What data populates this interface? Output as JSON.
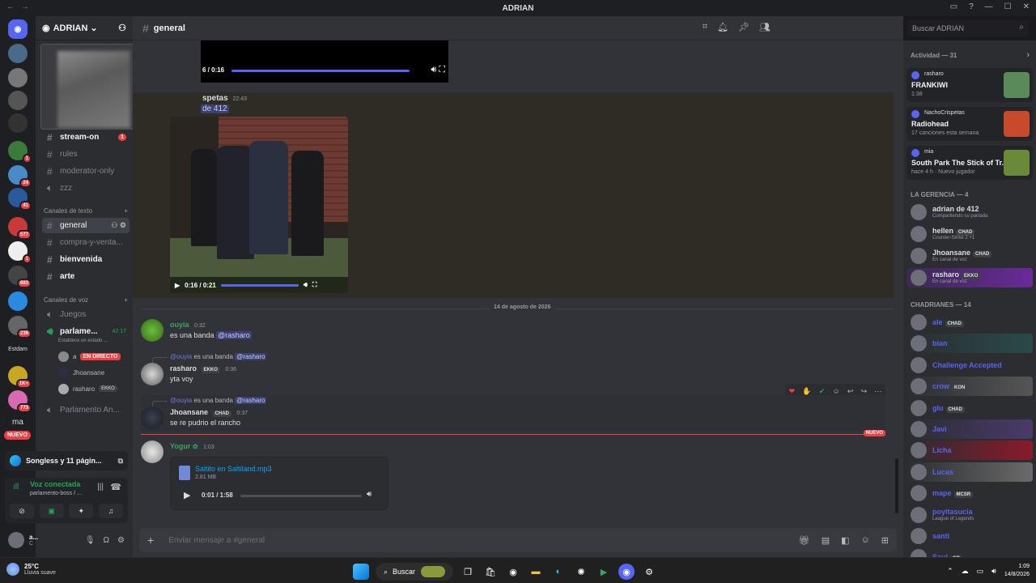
{
  "window": {
    "title": "ADRIAN"
  },
  "rail": {
    "servers": [
      {
        "label": "",
        "color": "#5865f2",
        "badge": ""
      },
      {
        "label": "",
        "color": "#4a6a8a",
        "badge": ""
      },
      {
        "label": "",
        "color": "#777777",
        "badge": ""
      },
      {
        "label": "",
        "color": "#555555",
        "badge": ""
      },
      {
        "label": "",
        "color": "#333333",
        "badge": ""
      },
      {
        "label": "",
        "color": "#3a7a3a",
        "badge": "1"
      },
      {
        "label": "",
        "color": "#4a8ac8",
        "badge": "24"
      },
      {
        "label": "",
        "color": "#2a5a9a",
        "badge": "41"
      },
      {
        "label": "",
        "color": "#c83a3a",
        "badge": "577"
      },
      {
        "label": "",
        "color": "#eeeeee",
        "badge": "1"
      },
      {
        "label": "",
        "color": "#444444",
        "badge": "683"
      },
      {
        "label": "",
        "color": "#2a8adf",
        "badge": ""
      },
      {
        "label": "",
        "color": "#666666",
        "badge": "236"
      }
    ],
    "folder_label": "Estdam",
    "ma_label": "ma",
    "server_badges_bottom": [
      "1K+",
      "773"
    ],
    "new_pill": "NUEVO"
  },
  "sidebar": {
    "guild_name": "ADRIAN",
    "channels_top": [
      {
        "name": "stream-on",
        "bold": true,
        "badge": "1"
      },
      {
        "name": "rules",
        "bold": false
      },
      {
        "name": "moderator-only",
        "bold": false
      },
      {
        "name": "zzz",
        "bold": false
      }
    ],
    "text_category": "Canales de texto",
    "text_channels": [
      {
        "name": "general",
        "active": true
      },
      {
        "name": "compra-y-venta...",
        "active": false
      },
      {
        "name": "bienvenida",
        "active": false,
        "bold": true
      },
      {
        "name": "arte",
        "active": false,
        "bold": true
      }
    ],
    "voice_category": "Canales de voz",
    "voice_channels": [
      {
        "name": "Juegos"
      },
      {
        "name": "parlame...",
        "timer": "42:17",
        "status": "Establece un estado ..."
      }
    ],
    "voice_users": [
      {
        "name": "a",
        "live": "EN DIRECTO"
      },
      {
        "name": "Jhoansane",
        "chip": ""
      },
      {
        "name": "rasharo",
        "chip": "EKKO"
      }
    ],
    "channel_after": "Parlamento An...",
    "edge_panel": "Songless y 11 págin...",
    "voice_panel": {
      "status": "Voz conectada",
      "sub": "parlamento-boss / ..."
    },
    "user": {
      "name": "a...",
      "sub": "C"
    }
  },
  "channel": {
    "name": "general",
    "search_placeholder": "Buscar ADRIAN"
  },
  "messages": {
    "video_strip_time": "6 / 0:16",
    "highlight_author": "spetas",
    "highlight_time": "22:43",
    "highlight_mention": "de 412",
    "video_time": "0:16 / 0:21",
    "date_divider": "14 de agosto de 2026",
    "items": [
      {
        "author": "ouyia",
        "color": "#3ba55c",
        "time": "0:32",
        "text": "es una banda",
        "mention": "@rasharo"
      },
      {
        "author": "rasharo",
        "color": "#dbdee1",
        "tag": "EKKO",
        "time": "0:36",
        "text": "yta voy",
        "reply_name": "@ouyia",
        "reply_text": "es una banda",
        "reply_mention": "@rasharo"
      },
      {
        "author": "Jhoansane",
        "color": "#dbdee1",
        "tag": "CHAD",
        "time": "0:37",
        "text": "se re pudrio el rancho",
        "reply_name": "@ouyia",
        "reply_text": "es una banda",
        "reply_mention": "@rasharo"
      },
      {
        "author": "Yogur",
        "color": "#3ba55c",
        "time": "1:03",
        "text": ""
      }
    ],
    "new_label": "NUEVO",
    "audio": {
      "file": "Saltito en Saltiland.mp3",
      "size": "2.81 MB",
      "time": "0:01 / 1:58"
    }
  },
  "composer": {
    "placeholder": "Enviar mensaje a #general"
  },
  "members": {
    "activity_header": "Actividad — 31",
    "activity": [
      {
        "user": "rasharo",
        "title": "FRANKIWI",
        "detail": "1:38",
        "art": "#5a8a5a"
      },
      {
        "user": "NachoCrispetas",
        "title": "Radiohead",
        "detail": "17 canciones esta semana",
        "art": "#c84a2a"
      },
      {
        "user": "mia",
        "title": "South Park The Stick of Tr...",
        "detail": "hace 4 h · Nuevo jugador",
        "art": "#6a8a3a"
      }
    ],
    "group1_header": "LA GERENCIA — 4",
    "group1": [
      {
        "name": "adrian de 412",
        "sub": "Compartiendo su pantalla",
        "color": "#dbdee1",
        "tag": ""
      },
      {
        "name": "hellen",
        "sub": "Counter-Strike 2 +1",
        "color": "#dbdee1",
        "tag": "CHAD"
      },
      {
        "name": "Jhoansane",
        "sub": "En canal de voz",
        "color": "#dbdee1",
        "tag": "CHAD"
      },
      {
        "name": "rasharo",
        "sub": "En canal de voz",
        "color": "#dbdee1",
        "tag": "EKKO"
      }
    ],
    "group2_header": "CHADRIANES — 14",
    "group2": [
      {
        "name": "ale",
        "sub": "",
        "color": "#5865f2",
        "tag": "CHAD"
      },
      {
        "name": "bian",
        "sub": "",
        "color": "#5865f2",
        "tag": ""
      },
      {
        "name": "Challenge Accepted",
        "sub": "",
        "color": "#5865f2",
        "tag": ""
      },
      {
        "name": "crow",
        "sub": "",
        "color": "#5865f2",
        "tag": "KON"
      },
      {
        "name": "glu",
        "sub": "",
        "color": "#5865f2",
        "tag": "CHAD"
      },
      {
        "name": "Javi",
        "sub": "",
        "color": "#5865f2",
        "tag": ""
      },
      {
        "name": "Licha",
        "sub": "",
        "color": "#5865f2",
        "tag": ""
      },
      {
        "name": "Lucas",
        "sub": "",
        "color": "#5865f2",
        "tag": ""
      },
      {
        "name": "mape",
        "sub": "",
        "color": "#5865f2",
        "tag": "MCSR"
      },
      {
        "name": "poyitasucia",
        "sub": "League of Legends",
        "color": "#5865f2",
        "tag": ""
      },
      {
        "name": "santi",
        "sub": "",
        "color": "#5865f2",
        "tag": ""
      },
      {
        "name": "Saul",
        "sub": "",
        "color": "#5865f2",
        "tag": "GB"
      }
    ]
  },
  "taskbar": {
    "temp": "25°C",
    "condition": "Lluvia suave",
    "search_label": "Buscar",
    "time": "1:09",
    "date": "14/8/2026"
  }
}
